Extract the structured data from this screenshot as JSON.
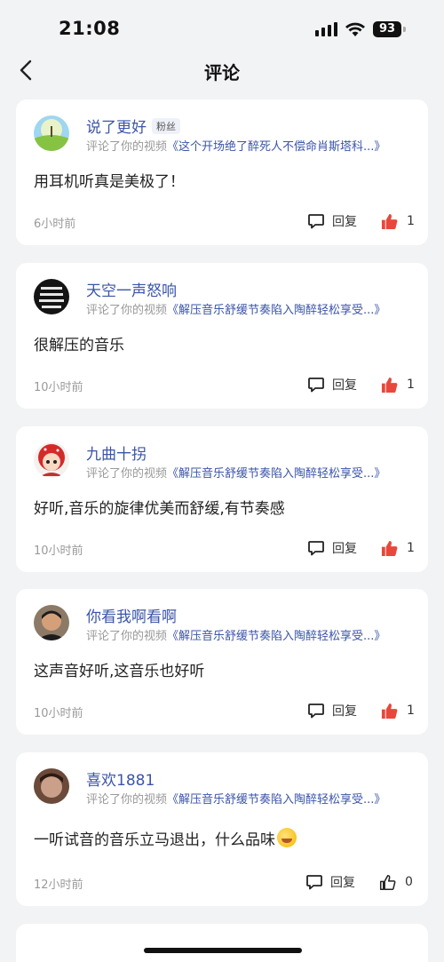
{
  "status_bar": {
    "time": "21:08",
    "battery": "93"
  },
  "header": {
    "title": "评论"
  },
  "comments": [
    {
      "username": "说了更好",
      "badge": "粉丝",
      "action_prefix": "评论了你的视频",
      "video_title": "《这个开场绝了醉死人不偿命肖斯塔科...》",
      "text": "用耳机听真是美极了！",
      "time": "6小时前",
      "reply_label": "回复",
      "like_count": "1",
      "liked": true
    },
    {
      "username": "天空一声怒响",
      "badge": "",
      "action_prefix": "评论了你的视频",
      "video_title": "《解压音乐舒缓节奏陷入陶醉轻松享受...》",
      "text": "很解压的音乐",
      "time": "10小时前",
      "reply_label": "回复",
      "like_count": "1",
      "liked": true
    },
    {
      "username": "九曲十拐",
      "badge": "",
      "action_prefix": "评论了你的视频",
      "video_title": "《解压音乐舒缓节奏陷入陶醉轻松享受...》",
      "text": "好听,音乐的旋律优美而舒缓,有节奏感",
      "time": "10小时前",
      "reply_label": "回复",
      "like_count": "1",
      "liked": true
    },
    {
      "username": "你看我啊看啊",
      "badge": "",
      "action_prefix": "评论了你的视频",
      "video_title": "《解压音乐舒缓节奏陷入陶醉轻松享受...》",
      "text": "这声音好听,这音乐也好听",
      "time": "10小时前",
      "reply_label": "回复",
      "like_count": "1",
      "liked": true
    },
    {
      "username": "喜欢1881",
      "badge": "",
      "action_prefix": "评论了你的视频",
      "video_title": "《解压音乐舒缓节奏陷入陶醉轻松享受...》",
      "text": "一听试音的音乐立马退出，什么品味",
      "time": "12小时前",
      "reply_label": "回复",
      "like_count": "0",
      "liked": false
    }
  ],
  "colors": {
    "accent": "#3b55a8",
    "like_red": "#e8483c",
    "background": "#f2f3f5"
  },
  "icons": {
    "back": "chevron-left-icon",
    "reply": "comment-bubble-icon",
    "like": "thumbs-up-icon",
    "emoji": "laughing-emoji"
  }
}
